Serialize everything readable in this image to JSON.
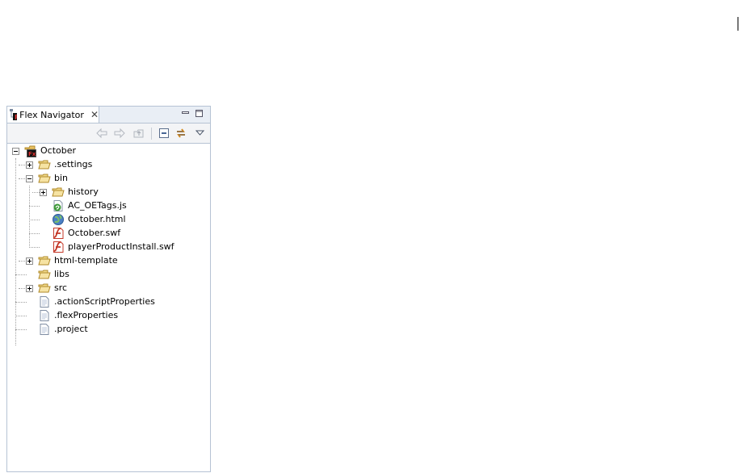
{
  "panel": {
    "tab_title": "Flex Navigator",
    "tab_icon": "flex-navigator-icon",
    "close_symbol": "✕"
  },
  "toolbar": {
    "buttons": [
      "back-arrow-icon",
      "forward-arrow-icon",
      "up-folder-icon",
      "collapse-all-icon",
      "link-editor-icon",
      "view-menu-icon"
    ]
  },
  "tree": {
    "root": {
      "label": "October",
      "icon": "flex-project-icon",
      "expanded": true
    },
    "items": [
      {
        "label": ".settings",
        "icon": "folder-icon",
        "expanded": false
      },
      {
        "label": "bin",
        "icon": "folder-icon",
        "expanded": true,
        "children": [
          {
            "label": "history",
            "icon": "folder-icon",
            "expanded": false
          },
          {
            "label": "AC_OETags.js",
            "icon": "js-file-icon"
          },
          {
            "label": "October.html",
            "icon": "html-file-icon"
          },
          {
            "label": "October.swf",
            "icon": "swf-file-icon"
          },
          {
            "label": "playerProductInstall.swf",
            "icon": "swf-file-icon"
          }
        ]
      },
      {
        "label": "html-template",
        "icon": "folder-icon",
        "expanded": false
      },
      {
        "label": "libs",
        "icon": "folder-icon"
      },
      {
        "label": "src",
        "icon": "folder-icon",
        "expanded": false
      },
      {
        "label": ".actionScriptProperties",
        "icon": "file-icon"
      },
      {
        "label": ".flexProperties",
        "icon": "file-icon"
      },
      {
        "label": ".project",
        "icon": "file-icon"
      }
    ]
  }
}
